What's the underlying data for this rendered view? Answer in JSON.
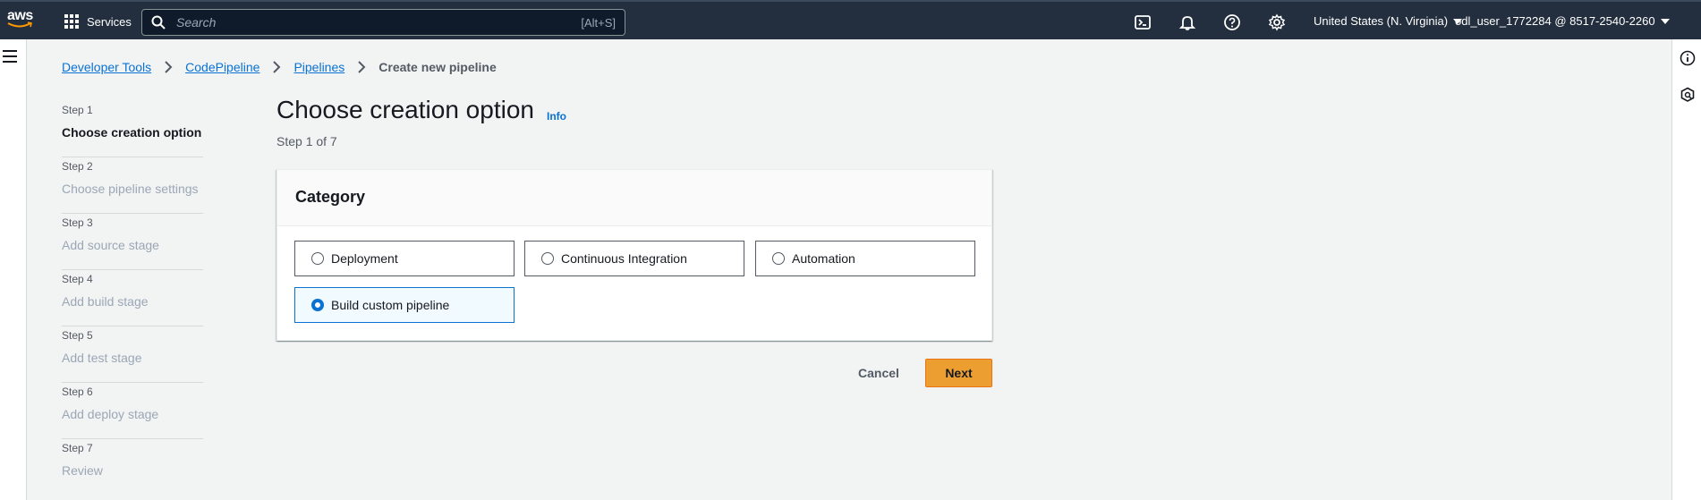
{
  "topnav": {
    "logo_text": "aws",
    "services_label": "Services",
    "search_placeholder": "Search",
    "search_shortcut": "[Alt+S]",
    "region": "United States (N. Virginia)",
    "account": "odl_user_1772284 @ 8517-2540-2260",
    "icons": [
      "cloudshell-icon",
      "notifications-icon",
      "help-icon",
      "settings-icon"
    ]
  },
  "breadcrumb": {
    "items": [
      "Developer Tools",
      "CodePipeline",
      "Pipelines"
    ],
    "current": "Create new pipeline"
  },
  "steps": [
    {
      "num": "Step 1",
      "title": "Choose creation option",
      "active": true
    },
    {
      "num": "Step 2",
      "title": "Choose pipeline settings",
      "active": false
    },
    {
      "num": "Step 3",
      "title": "Add source stage",
      "active": false
    },
    {
      "num": "Step 4",
      "title": "Add build stage",
      "active": false
    },
    {
      "num": "Step 5",
      "title": "Add test stage",
      "active": false
    },
    {
      "num": "Step 6",
      "title": "Add deploy stage",
      "active": false
    },
    {
      "num": "Step 7",
      "title": "Review",
      "active": false
    }
  ],
  "main": {
    "title": "Choose creation option",
    "info": "Info",
    "step_of": "Step 1 of 7",
    "category": {
      "header": "Category",
      "options": [
        {
          "label": "Deployment",
          "selected": false
        },
        {
          "label": "Continuous Integration",
          "selected": false
        },
        {
          "label": "Automation",
          "selected": false
        },
        {
          "label": "Build custom pipeline",
          "selected": true
        }
      ]
    },
    "cancel_label": "Cancel",
    "next_label": "Next"
  },
  "colors": {
    "nav_bg": "#232f3e",
    "link": "#0972d3",
    "primary_button": "#ec9f30",
    "selected_tile_bg": "#f1faff"
  }
}
